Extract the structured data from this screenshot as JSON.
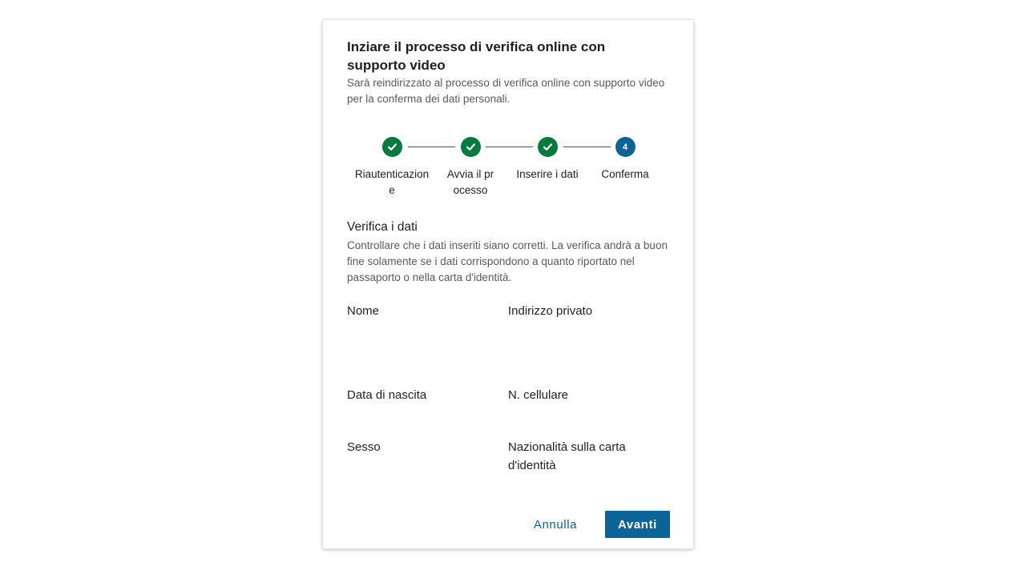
{
  "dialog": {
    "title": "Inziare il processo di verifica online con supporto video",
    "subtitle": "Sarà reindirizzato al processo di verifica online con supporto video per la conferma dei dati personali."
  },
  "stepper": {
    "steps": [
      {
        "number": "1",
        "label": "Riautenticazione",
        "status": "completed",
        "icon": "check-icon"
      },
      {
        "number": "2",
        "label": "Avvia il processo",
        "status": "completed",
        "icon": "check-icon"
      },
      {
        "number": "3",
        "label": "Inserire i dati",
        "status": "completed",
        "icon": "check-icon"
      },
      {
        "number": "4",
        "label": "Conferma",
        "status": "active"
      }
    ]
  },
  "section": {
    "title": "Verifica i dati",
    "description": "Controllare che i dati inseriti siano corretti. La verifica andrà a buon fine solamente se i dati corrispondono a quanto riportato nel passaporto o nella carta d'identità."
  },
  "fields": {
    "name": {
      "label": "Nome",
      "value": ""
    },
    "private_address": {
      "label": "Indirizzo privato",
      "value": ""
    },
    "birth_date": {
      "label": "Data di nascita",
      "value": ""
    },
    "mobile": {
      "label": "N. cellulare",
      "value": ""
    },
    "sex": {
      "label": "Sesso",
      "value": ""
    },
    "nationality": {
      "label": "Nazionalità sulla carta d'identità",
      "value": ""
    }
  },
  "actions": {
    "cancel_label": "Annulla",
    "next_label": "Avanti"
  },
  "colors": {
    "accent": "#0b6396",
    "success": "#007a3d",
    "text": "#1f1f1f",
    "muted_text": "#5a5a5a"
  }
}
